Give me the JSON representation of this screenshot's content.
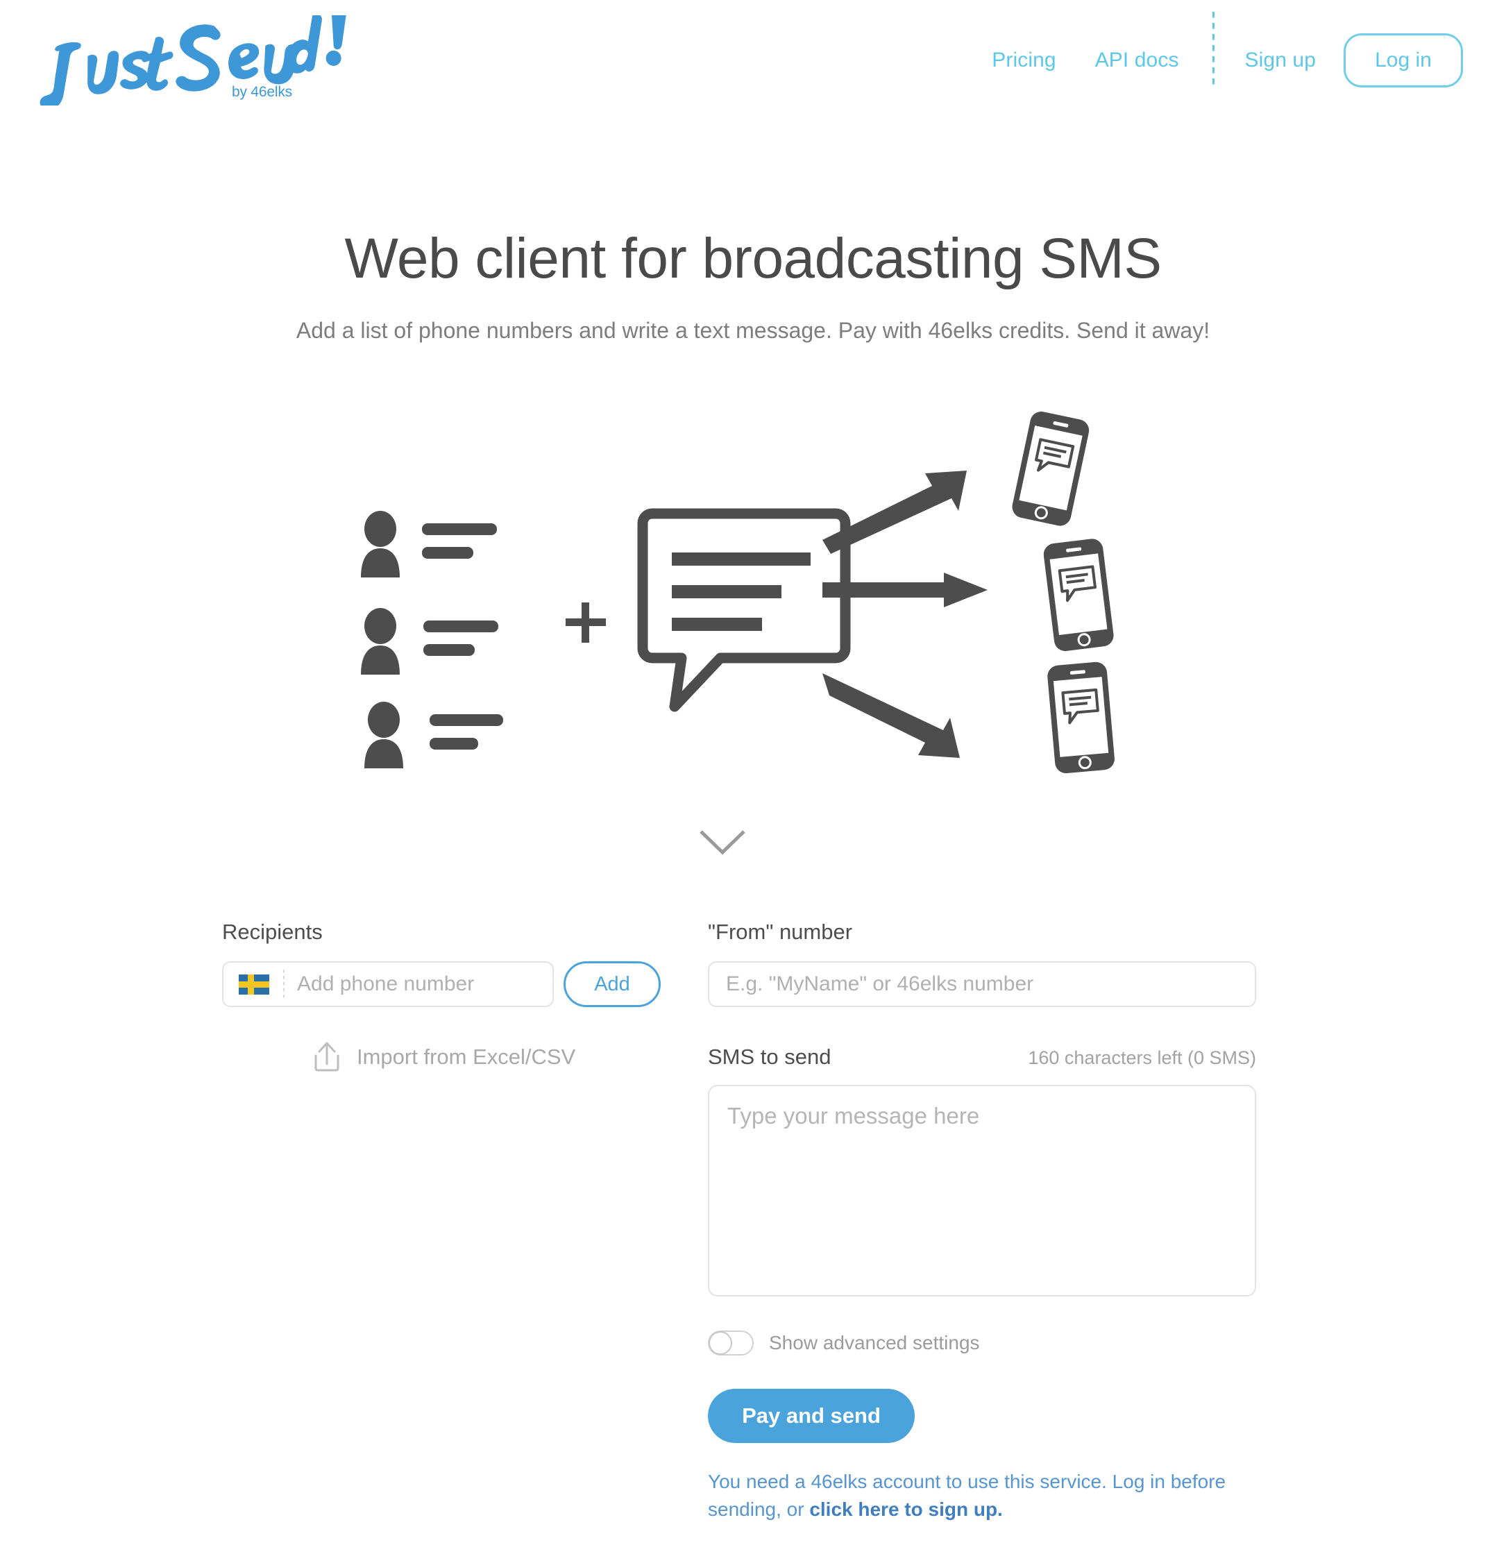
{
  "brand": {
    "logo_text": "Just Send!",
    "logo_byline": "by 46elks",
    "accent_light": "#5BC8E8",
    "accent_blue": "#4BA3DC",
    "link_blue": "#5596D2"
  },
  "nav": {
    "pricing": "Pricing",
    "api_docs": "API docs",
    "sign_up": "Sign up",
    "log_in": "Log in"
  },
  "hero": {
    "title": "Web client for broadcasting SMS",
    "subtitle": "Add a list of phone numbers and write a text message. Pay with 46elks credits. Send it away!"
  },
  "illustration": {
    "people_count": 3,
    "arrow_count": 3,
    "phone_count": 3,
    "plus_symbol": "+",
    "icon_color": "#4d4d4d"
  },
  "scroll_hint": {
    "icon": "chevron-down-icon"
  },
  "form": {
    "recipients": {
      "label": "Recipients",
      "country_flag": "sweden-flag-icon",
      "phone_placeholder": "Add phone number",
      "phone_value": "",
      "add_button": "Add",
      "import_icon": "upload-icon",
      "import_label": "Import from Excel/CSV"
    },
    "from": {
      "label": "\"From\" number",
      "placeholder": "E.g. \"MyName\" or 46elks number",
      "value": ""
    },
    "message": {
      "label": "SMS to send",
      "char_count": "160 characters left (0 SMS)",
      "placeholder": "Type your message here",
      "value": ""
    },
    "advanced": {
      "label": "Show advanced settings",
      "enabled": false
    },
    "submit": {
      "label": "Pay and send"
    },
    "notice": {
      "text": "You need a 46elks account to use this service. Log in before sending, or ",
      "link_text": "click here to sign up."
    }
  }
}
